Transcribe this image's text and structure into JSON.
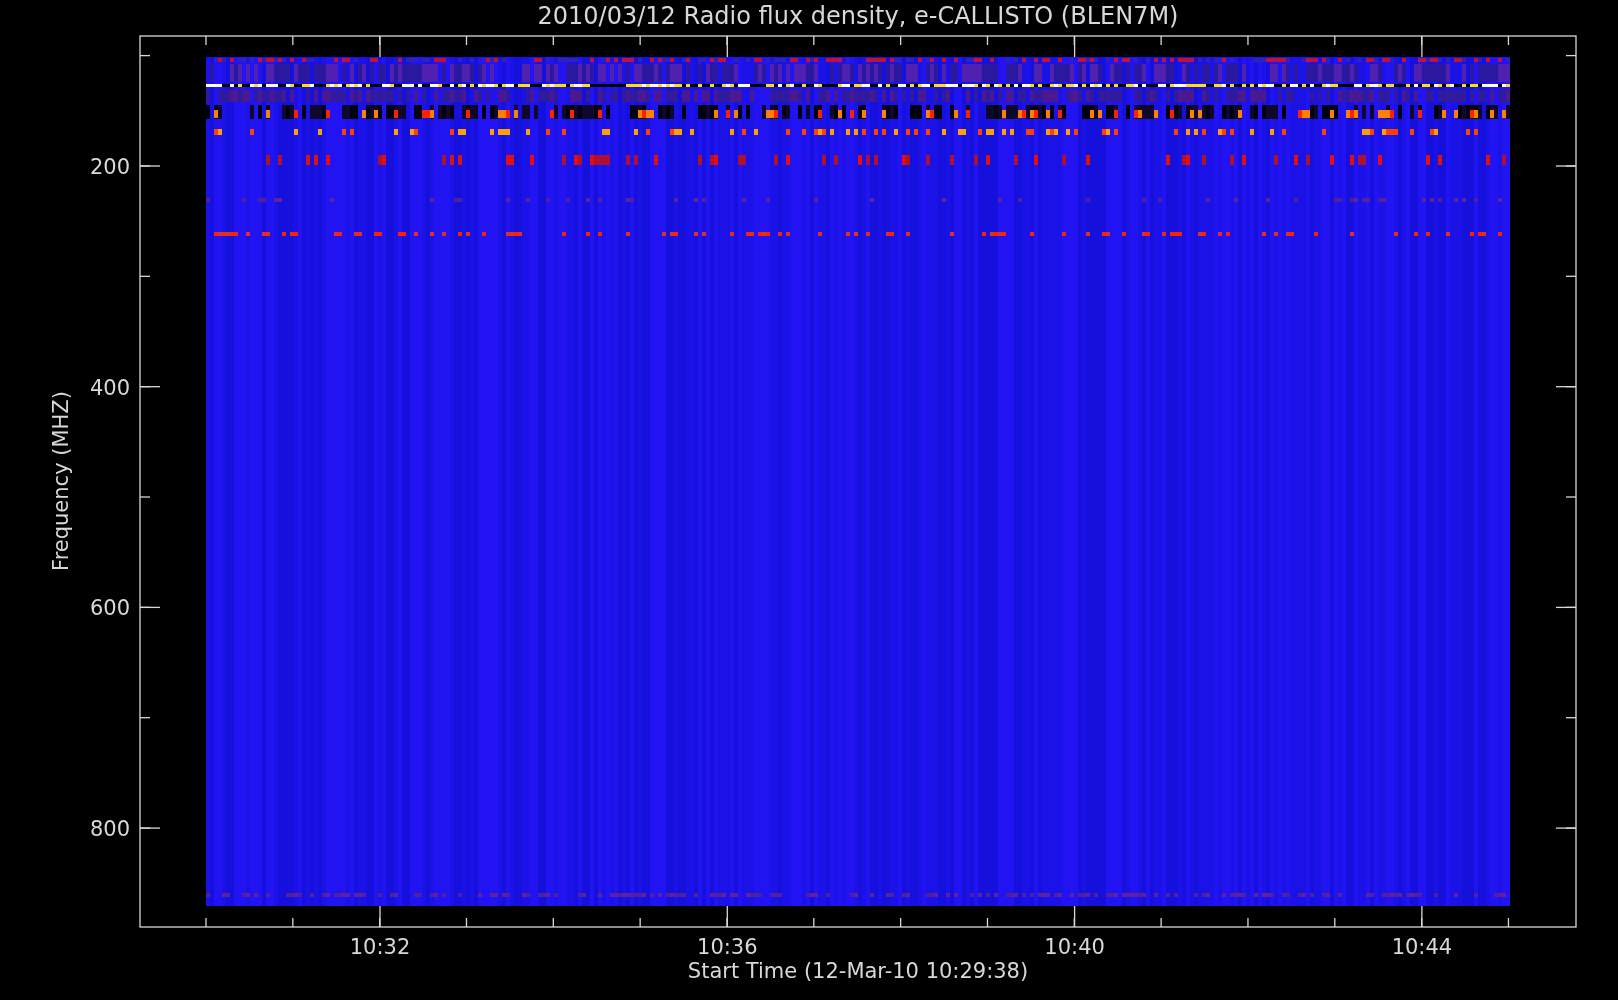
{
  "title": "2010/03/12  Radio flux density, e-CALLISTO (BLEN7M)",
  "xlabel": "Start Time (12-Mar-10 10:29:38)",
  "ylabel": "Frequency (MHZ)",
  "xticks": [
    "10:32",
    "10:36",
    "10:40",
    "10:44"
  ],
  "yticks": [
    "200",
    "400",
    "600",
    "800"
  ]
}
